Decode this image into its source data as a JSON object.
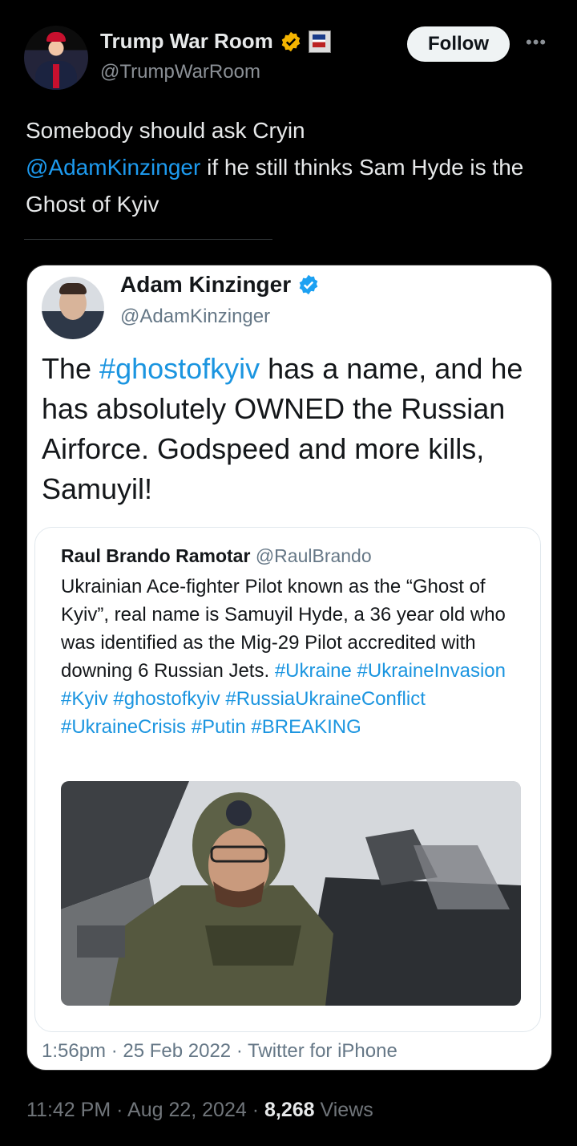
{
  "post": {
    "author_name": "Trump War Room",
    "author_handle": "@TrumpWarRoom",
    "follow_label": "Follow",
    "more_icon": "more-icon",
    "text_before": "Somebody should ask Cryin",
    "mention": "@AdamKinzinger",
    "text_after": " if he still thinks Sam Hyde is the Ghost of Kyiv",
    "time": "11:42 PM",
    "date": "Aug 22, 2024",
    "views_count": "8,268",
    "views_label": "Views",
    "meta_separator": "·"
  },
  "quoted": {
    "author_name": "Adam Kinzinger",
    "author_handle": "@AdamKinzinger",
    "text_before": "The ",
    "hashtag": "#ghostofkyiv",
    "text_after": " has a name, and he has absolutely OWNED the Russian Airforce.  Godspeed and more kills, Samuyil!",
    "footer": "1:56pm · 25 Feb 2022 · Twitter for iPhone"
  },
  "inner": {
    "author_name": "Raul Brando Ramotar",
    "author_handle": "@RaulBrando",
    "text": "Ukrainian Ace-fighter Pilot known as the “Ghost of Kyiv”, real name is Samuyil Hyde, a 36 year old who was identified as the Mig-29 Pilot accredited with downing 6 Russian Jets.",
    "hashtags": "#Ukraine #UkraineInvasion #Kyiv #ghostofkyiv #RussiaUkraineConflict #UkraineCrisis #Putin #BREAKING"
  },
  "colors": {
    "background": "#000000",
    "link": "#1d9bf0",
    "verified_gold": "#f4b400",
    "verified_blue": "#1da1f2"
  }
}
